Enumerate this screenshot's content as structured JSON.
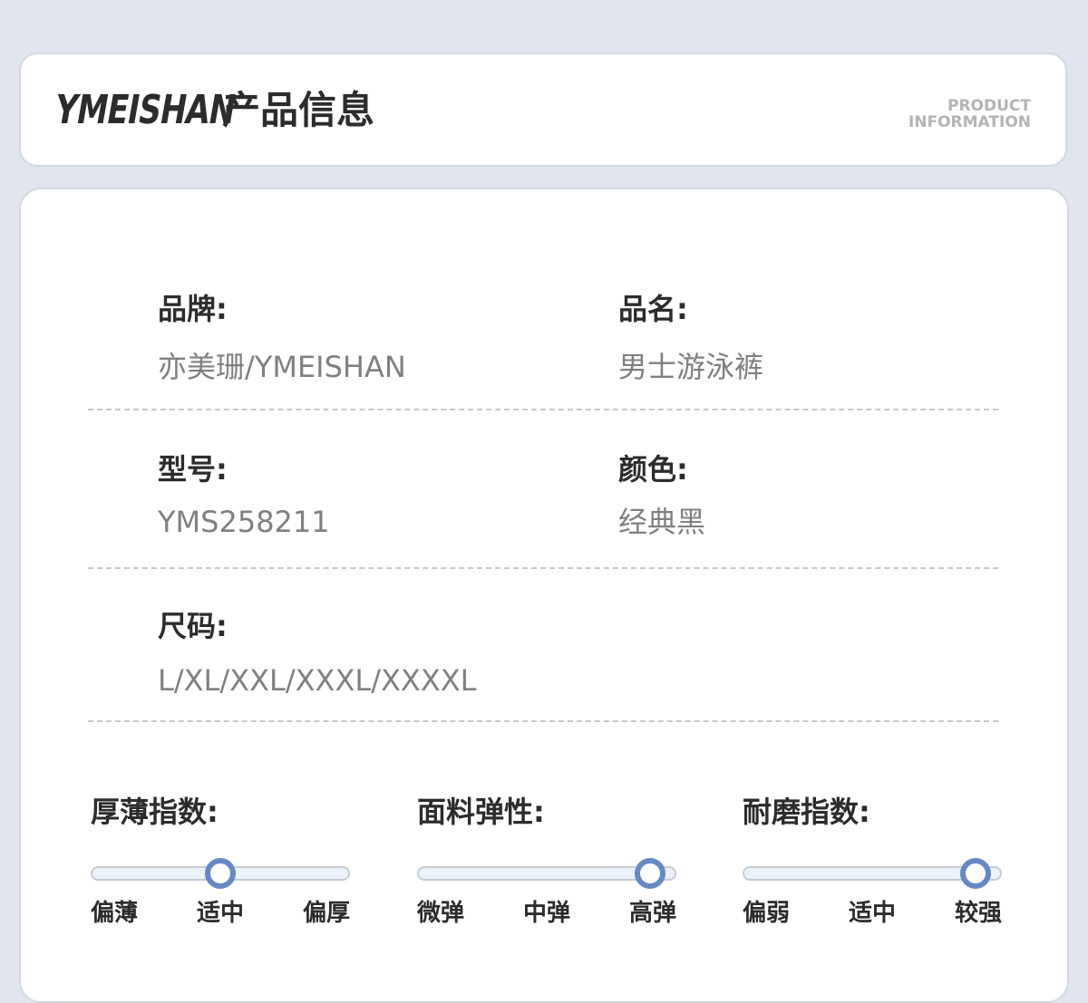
{
  "header": {
    "brand": "YMEISHAN",
    "title": "产品信息",
    "subtitle_line1": "PRODUCT",
    "subtitle_line2": "INFORMATION"
  },
  "fields": {
    "brand": {
      "label": "品牌:",
      "value": "亦美珊/YMEISHAN"
    },
    "name": {
      "label": "品名:",
      "value": "男士游泳裤"
    },
    "model": {
      "label": "型号:",
      "value": "YMS258211"
    },
    "color": {
      "label": "颜色:",
      "value": "经典黑"
    },
    "size": {
      "label": "尺码:",
      "value": "L/XL/XXL/XXXL/XXXXL"
    }
  },
  "meters": [
    {
      "title": "厚薄指数:",
      "labels": [
        "偏薄",
        "适中",
        "偏厚"
      ],
      "level": 0.5
    },
    {
      "title": "面料弹性:",
      "labels": [
        "微弹",
        "中弹",
        "高弹"
      ],
      "level": 0.9
    },
    {
      "title": "耐磨指数:",
      "labels": [
        "偏弱",
        "适中",
        "较强"
      ],
      "level": 0.9
    }
  ],
  "colors": {
    "accent": "#6689c5",
    "track_fill": "#ebf2f9",
    "text_dark": "#2c2c2c",
    "text_muted": "#808080",
    "background": "#e1e5ee"
  }
}
